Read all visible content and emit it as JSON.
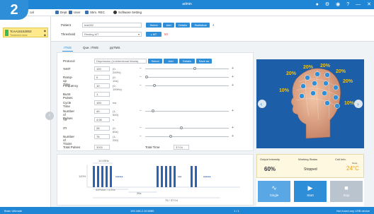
{
  "badge": "2",
  "window": {
    "title": "admin"
  },
  "menubar": {
    "items": [
      {
        "label": "cal",
        "icon": "cal-icon"
      },
      {
        "label": "Dept",
        "icon": "dept-icon"
      },
      {
        "label": "User",
        "icon": "user-icon"
      },
      {
        "label": "Stim. REC",
        "icon": "record-icon"
      },
      {
        "label": "Software Setting",
        "icon": "gear-icon"
      }
    ]
  },
  "patient_card": {
    "id": "TcAA16152853",
    "sub": "Treatment done"
  },
  "form": {
    "patient_label": "Patient",
    "patient_value": "test052",
    "threshold_label": "Threshold",
    "threshold_value": "Resting MT",
    "select_btn": "Select",
    "add_btn": "Add",
    "details_btn": "Details",
    "statistical_btn": "Statistical",
    "count": "4",
    "mt_btn": "MT",
    "mt_value": "50"
  },
  "tabs": [
    "rTMS",
    "Que. rTMS",
    "ppTMS"
  ],
  "protocol": {
    "label": "Protocol",
    "value": "Depression (Unintentional Mania)",
    "select_btn": "Select",
    "add_btn": "Add",
    "details_btn": "Details",
    "save_btn": "Save as"
  },
  "params": [
    {
      "label": "%MT",
      "value": "120",
      "range": "(0-200%)",
      "knob": 0.6
    },
    {
      "label": "Ramp-up Time",
      "value": "0",
      "range": "(0-10s)",
      "knob": 0.0
    },
    {
      "label": "Frequency",
      "value": "10",
      "range": "(0-100Hz)",
      "knob": 0.1
    },
    {
      "label": "Burst Pulses",
      "value": "1",
      "range": "",
      "knob": null
    },
    {
      "label": "Cycle Time",
      "value": "100",
      "range": "ms",
      "knob": null
    },
    {
      "label": "Number of Pulses",
      "value": "40",
      "range": "(1-500)",
      "knob": 0.08
    },
    {
      "label": "T0",
      "value": "4.00",
      "range": "s",
      "knob": null
    },
    {
      "label": "ITI",
      "value": "26",
      "range": "(0-60s)",
      "knob": 0.43
    },
    {
      "label": "Number of Trains",
      "value": "75",
      "range": "(1-250)",
      "knob": 0.3
    }
  ],
  "totals": {
    "pulses_label": "Total Pulses",
    "pulses_value": "3000",
    "time_label": "Total Time",
    "time_value": "37:04"
  },
  "head_labels": [
    "20%",
    "20%",
    "20%",
    "20%",
    "20%",
    "10%",
    "10%"
  ],
  "waveform": {
    "top_label": "10.00Hz",
    "y_label": "120%",
    "pulses_label": "40Pulse / 4.00s",
    "iti_label": "26s",
    "trains_label": "75 / 37:04"
  },
  "status": {
    "intensity_label": "Output Intensity",
    "intensity_value": "60%",
    "working_label": "Working Status",
    "working_value": "Stopped",
    "coil_label": "Coil Info.",
    "coil_temp_label": "Temp",
    "coil_value": "24°C"
  },
  "controls": [
    {
      "label": "Single",
      "icon": "single-pulse-icon",
      "color": "#5aa7e6"
    },
    {
      "label": "Start",
      "icon": "play-icon",
      "color": "#2e8fd8"
    },
    {
      "label": "Stop",
      "icon": "stop-icon",
      "color": "#b9c4cf"
    }
  ],
  "statusbar": {
    "left": "Brain Ultimate",
    "center": "192.168.2.10:8080",
    "page": "1 / 1",
    "right": "Not found any USB device"
  },
  "colors": {
    "primary": "#1f86d6",
    "accent": "#2e8fd8",
    "card": "#ffe98a"
  }
}
